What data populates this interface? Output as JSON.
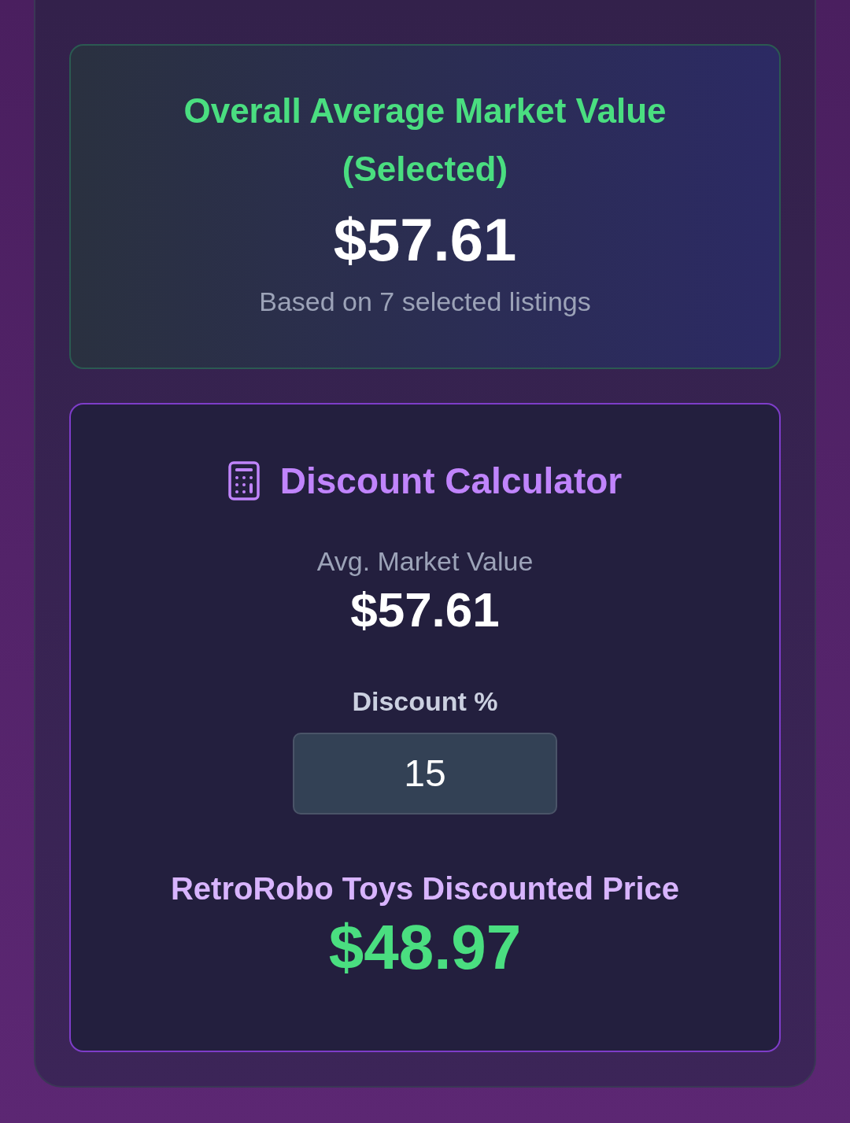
{
  "summary": {
    "title": "Overall Average Market Value (Selected)",
    "value": "$57.61",
    "note": "Based on 7 selected listings"
  },
  "calculator": {
    "title": "Discount Calculator",
    "avg_label": "Avg. Market Value",
    "avg_value": "$57.61",
    "discount_label": "Discount %",
    "discount_value": "15",
    "result_label": "RetroRobo Toys Discounted Price",
    "result_value": "$48.97"
  }
}
